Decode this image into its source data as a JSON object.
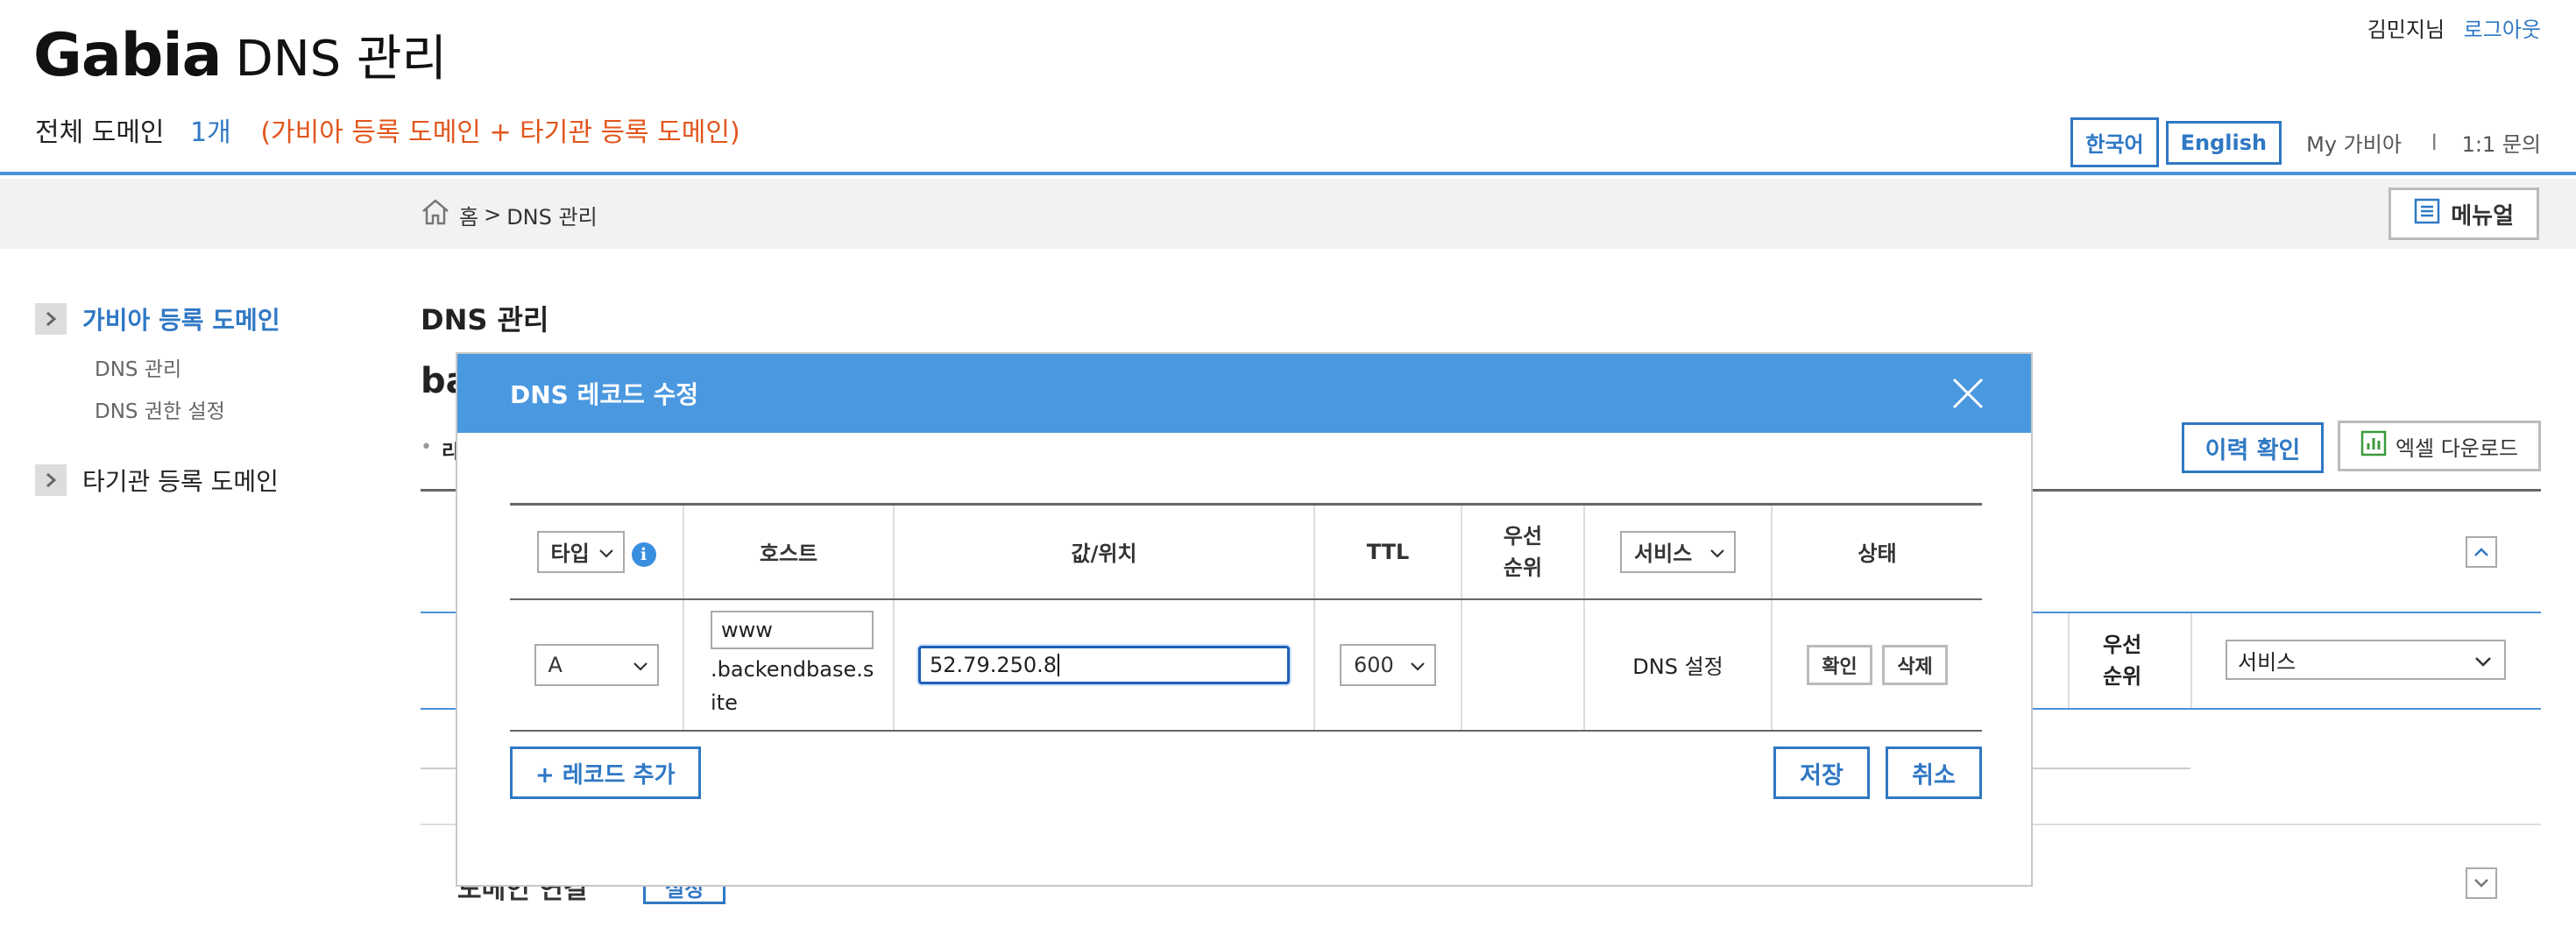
{
  "header": {
    "brand": "Gabia",
    "title": "DNS 관리",
    "domain_label": "전체 도메인",
    "domain_count": "1개",
    "domain_note": "(가비아 등록 도메인 + 타기관 등록 도메인)",
    "user_name": "김민지님",
    "logout": "로그아웃",
    "lang_ko": "한국어",
    "lang_en": "English",
    "my_gabia": "My 가비아",
    "separator": "l",
    "inquiry": "1:1 문의"
  },
  "breadcrumb": {
    "home": "홈",
    "sep": ">",
    "current": "DNS 관리",
    "manual": "메뉴얼"
  },
  "sidebar": {
    "groups": [
      {
        "label": "가비아 등록 도메인",
        "items": [
          "DNS 관리",
          "DNS 권한 설정"
        ]
      },
      {
        "label": "타기관 등록 도메인",
        "items": []
      }
    ]
  },
  "page": {
    "title": "DNS 관리",
    "partial_domain": "ba",
    "partial_bullet": "• ",
    "partial_label": "리",
    "history_button": "이력 확인",
    "excel_button": "엑셀 다운로드",
    "bg_priority": "우선\n순위",
    "bg_service": "서비스",
    "bg_partial_bottom": "도메인 연결",
    "bg_partial_bottom_btn": "설정"
  },
  "modal": {
    "title": "DNS 레코드 수정",
    "headers": {
      "type": "타입",
      "host": "호스트",
      "value": "값/위치",
      "ttl": "TTL",
      "priority": "우선\n순위",
      "service": "서비스",
      "status": "상태"
    },
    "record": {
      "type": "A",
      "host": "www",
      "host_suffix": ".backendbase.site",
      "value": "52.79.250.8",
      "ttl": "600",
      "priority": "",
      "service": "DNS 설정",
      "confirm": "확인",
      "delete": "삭제"
    },
    "add_record": "+ 레코드 추가",
    "save": "저장",
    "cancel": "취소"
  },
  "colors": {
    "accent": "#2f78c4",
    "modal_header": "#4a98e0",
    "note_orange": "#e2551d"
  }
}
